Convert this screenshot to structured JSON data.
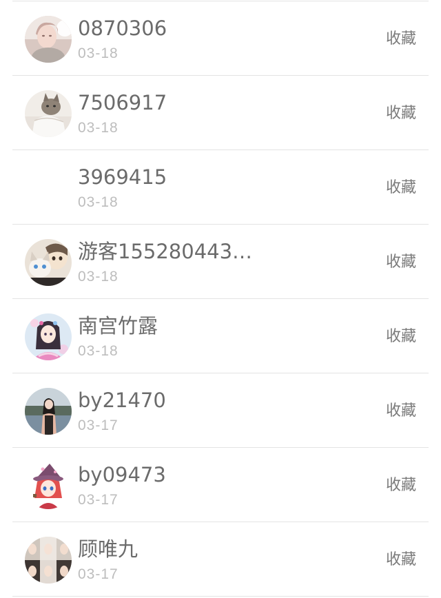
{
  "items": [
    {
      "name": "0870306",
      "date": "03-18",
      "action": "收藏",
      "avatar": "avatar-woman-photo-icon"
    },
    {
      "name": "7506917",
      "date": "03-18",
      "action": "收藏",
      "avatar": "avatar-cat-photo-icon"
    },
    {
      "name": "3969415",
      "date": "03-18",
      "action": "收藏",
      "avatar": ""
    },
    {
      "name": "游客155280443…",
      "date": "03-18",
      "action": "收藏",
      "avatar": "avatar-anime-cat-icon"
    },
    {
      "name": "南宫竹露",
      "date": "03-18",
      "action": "收藏",
      "avatar": "avatar-anime-girl-icon"
    },
    {
      "name": "by21470",
      "date": "03-17",
      "action": "收藏",
      "avatar": "avatar-girl-seaside-icon"
    },
    {
      "name": "by09473",
      "date": "03-17",
      "action": "收藏",
      "avatar": "avatar-anime-witch-icon"
    },
    {
      "name": "顾唯九",
      "date": "03-17",
      "action": "收藏",
      "avatar": "avatar-collage-icon"
    }
  ],
  "colors": {
    "name_text": "#6b6b6b",
    "date_text": "#bdbdbd",
    "action_text": "#7a7a7a",
    "divider": "#e3e3e3",
    "background": "#ffffff"
  }
}
